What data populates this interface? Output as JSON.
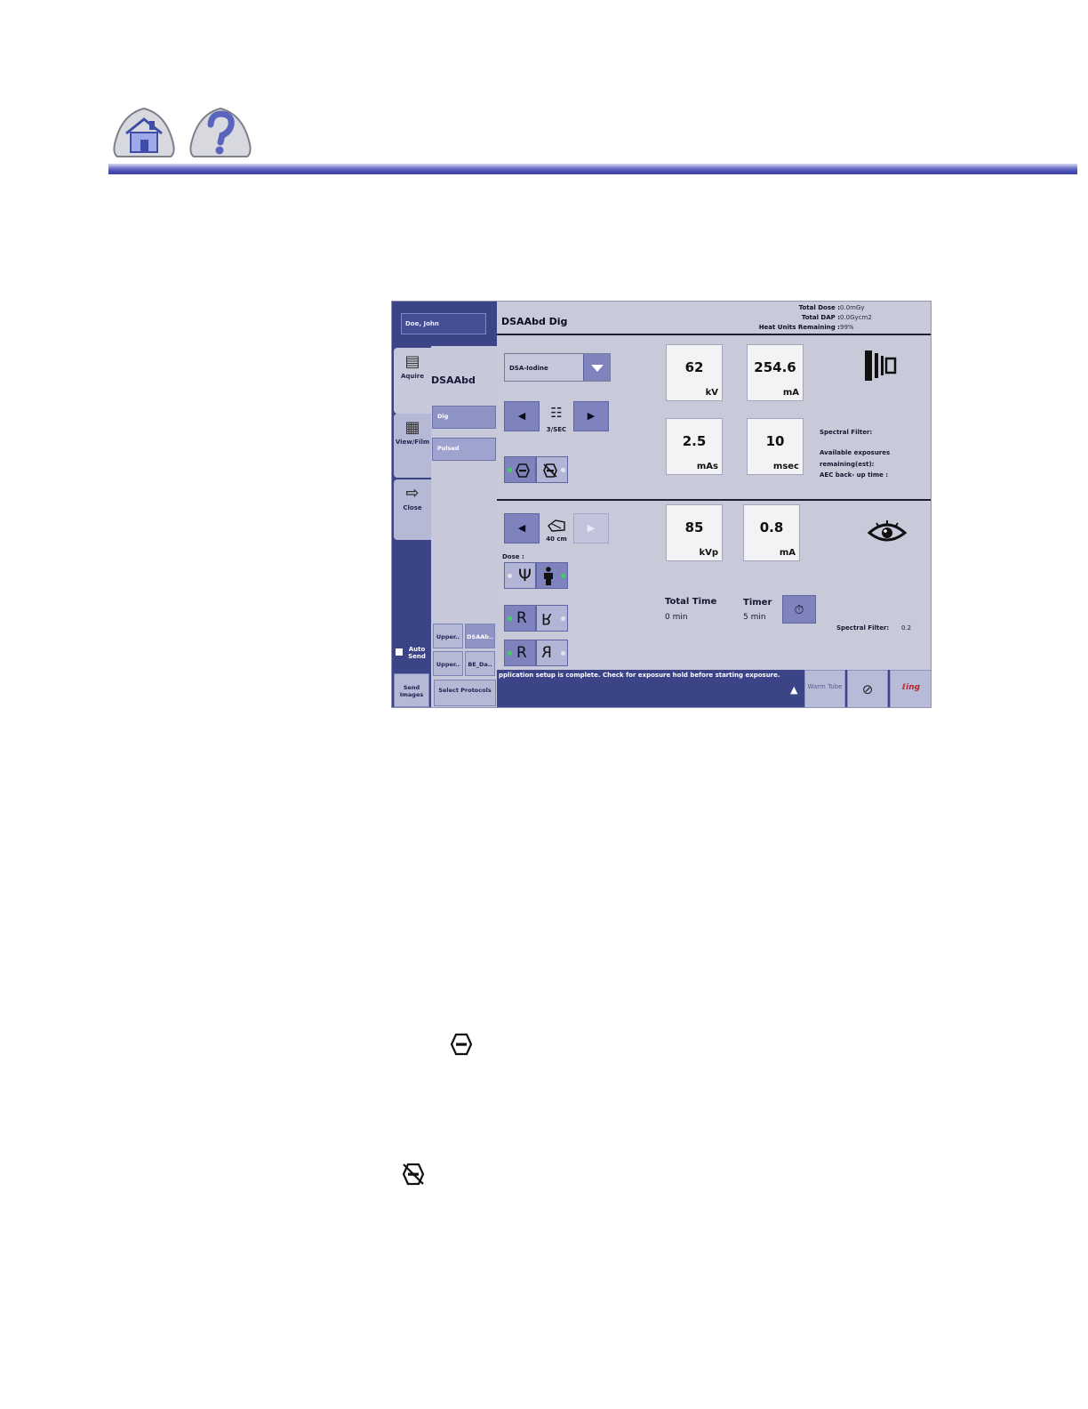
{
  "header": {
    "home_icon": "home-icon",
    "help_icon": "help-icon"
  },
  "app": {
    "patient_name": "Doe, John",
    "screen_title": "DSAAbd  Dig",
    "dose": {
      "total_dose_label": "Total Dose :",
      "total_dose_value": "0.0mGy",
      "total_dap_label": "Total DAP :",
      "total_dap_value": "0.0Gycm2",
      "heat_units_label": "Heat Units Remaining :",
      "heat_units_value": "99%"
    },
    "sidebar": {
      "tabs": [
        {
          "label": "Aquire",
          "icon": "acquire-icon"
        },
        {
          "label": "View/Film",
          "icon": "view-film-icon"
        },
        {
          "label": "Close",
          "icon": "close-exam-icon"
        }
      ],
      "auto_send": "Auto Send",
      "send_images": "Send Images"
    },
    "protocols": {
      "title": "DSAAbd",
      "items": [
        "Dig",
        "Pulsed"
      ],
      "recent": [
        "Upper..",
        "DSAAb..",
        "Upper..",
        "BE_Da.."
      ],
      "select_label": "Select Protocols"
    },
    "acquisition": {
      "dropdown_value": "DSA-Iodine",
      "frame_rate": "3/SEC",
      "kv": {
        "value": "62",
        "unit": "kV"
      },
      "ma": {
        "value": "254.6",
        "unit": "mA"
      },
      "mas": {
        "value": "2.5",
        "unit": "mAs"
      },
      "msec": {
        "value": "10",
        "unit": "msec"
      },
      "spectral_filter_label": "Spectral Filter:",
      "available_exposures_label": "Available exposures remaining(est):",
      "aec_backup_label": "AEC back- up time :"
    },
    "fluoro": {
      "distance": "40 cm",
      "dose_label": "Dose :",
      "kvp": {
        "value": "85",
        "unit": "kVp"
      },
      "ma": {
        "value": "0.8",
        "unit": "mA"
      },
      "total_time_label": "Total Time",
      "total_time_value": "0 min",
      "timer_label": "Timer",
      "timer_value": "5 min",
      "spectral_filter_label": "Spectral Filter:",
      "spectral_filter_value": "0.2"
    },
    "status_message": "pplication setup is complete. Check for exposure hold before starting exposure.",
    "bottom_buttons": {
      "warm_tube": "Warm Tube"
    }
  },
  "colors": {
    "app_navy": "#3b4487",
    "button_blue": "#7e83bd",
    "rule_blue": "#4a4fb3"
  }
}
